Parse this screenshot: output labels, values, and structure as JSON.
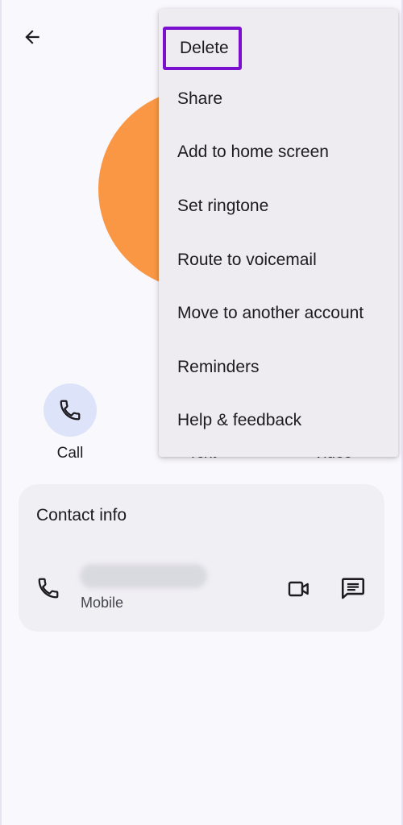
{
  "menu": {
    "items": [
      {
        "label": "Delete",
        "highlighted": true
      },
      {
        "label": "Share"
      },
      {
        "label": "Add to home screen"
      },
      {
        "label": "Set ringtone"
      },
      {
        "label": "Route to voicemail"
      },
      {
        "label": "Move to another account"
      },
      {
        "label": "Reminders"
      },
      {
        "label": "Help & feedback"
      }
    ],
    "highlight_color": "#7a0fcf"
  },
  "actions": {
    "call_label": "Call",
    "text_label": "Text",
    "video_label": "Video"
  },
  "contact_info": {
    "title": "Contact info",
    "phone_type": "Mobile"
  },
  "colors": {
    "avatar": "#fa9745",
    "call_button_bg": "#dde3f8",
    "card_bg": "#f0eff4",
    "menu_bg": "#eeecf1"
  }
}
